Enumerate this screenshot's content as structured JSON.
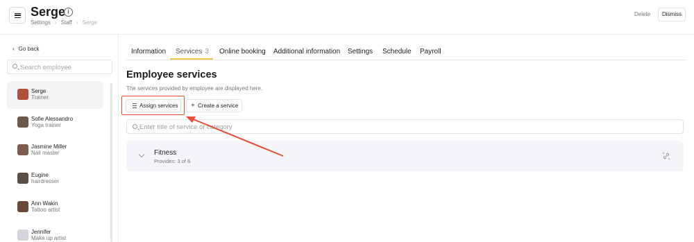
{
  "header": {
    "title": "Serge",
    "breadcrumbs": [
      "Settings",
      "Staff",
      "Serge"
    ],
    "delete_label": "Delete",
    "dismiss_label": "Dismiss"
  },
  "sidebar": {
    "back_label": "Go back",
    "search_placeholder": "Search employee",
    "employees": [
      {
        "name": "Serge",
        "role": "Trainer",
        "active": true,
        "avatar_color": "#b0503a"
      },
      {
        "name": "Sofie Alessandro",
        "role": "Yoga trainer",
        "active": false,
        "avatar_color": "#6d5a4c"
      },
      {
        "name": "Jasmine Miller",
        "role": "Nail master",
        "active": false,
        "avatar_color": "#7c5e4c"
      },
      {
        "name": "Eugine",
        "role": "hairdresser",
        "active": false,
        "avatar_color": "#5c4e42"
      },
      {
        "name": "Ann Wakin",
        "role": "Tattoo artist",
        "active": false,
        "avatar_color": "#6a4738"
      },
      {
        "name": "Jennifer",
        "role": "Make up artist",
        "active": false,
        "avatar_color": "#d4d6de"
      }
    ]
  },
  "tabs": [
    {
      "label": "Information"
    },
    {
      "label": "Services",
      "count": "3",
      "active": true
    },
    {
      "label": "Online booking"
    },
    {
      "label": "Additional information"
    },
    {
      "label": "Settings"
    },
    {
      "label": "Schedule"
    },
    {
      "label": "Payroll"
    }
  ],
  "main": {
    "heading": "Employee services",
    "subtitle": "The services provided by employee are displayed here.",
    "assign_label": "Assign services",
    "create_label": "Create a service",
    "search_placeholder": "Enter title of service or category",
    "categories": [
      {
        "name": "Fitness",
        "provides": "Provides: 3 of 6"
      }
    ]
  },
  "colors": {
    "accent": "#f5c84b",
    "highlight": "#e84c36",
    "active_bg": "#f3f4f6",
    "category_bg": "#f4f5f8"
  }
}
